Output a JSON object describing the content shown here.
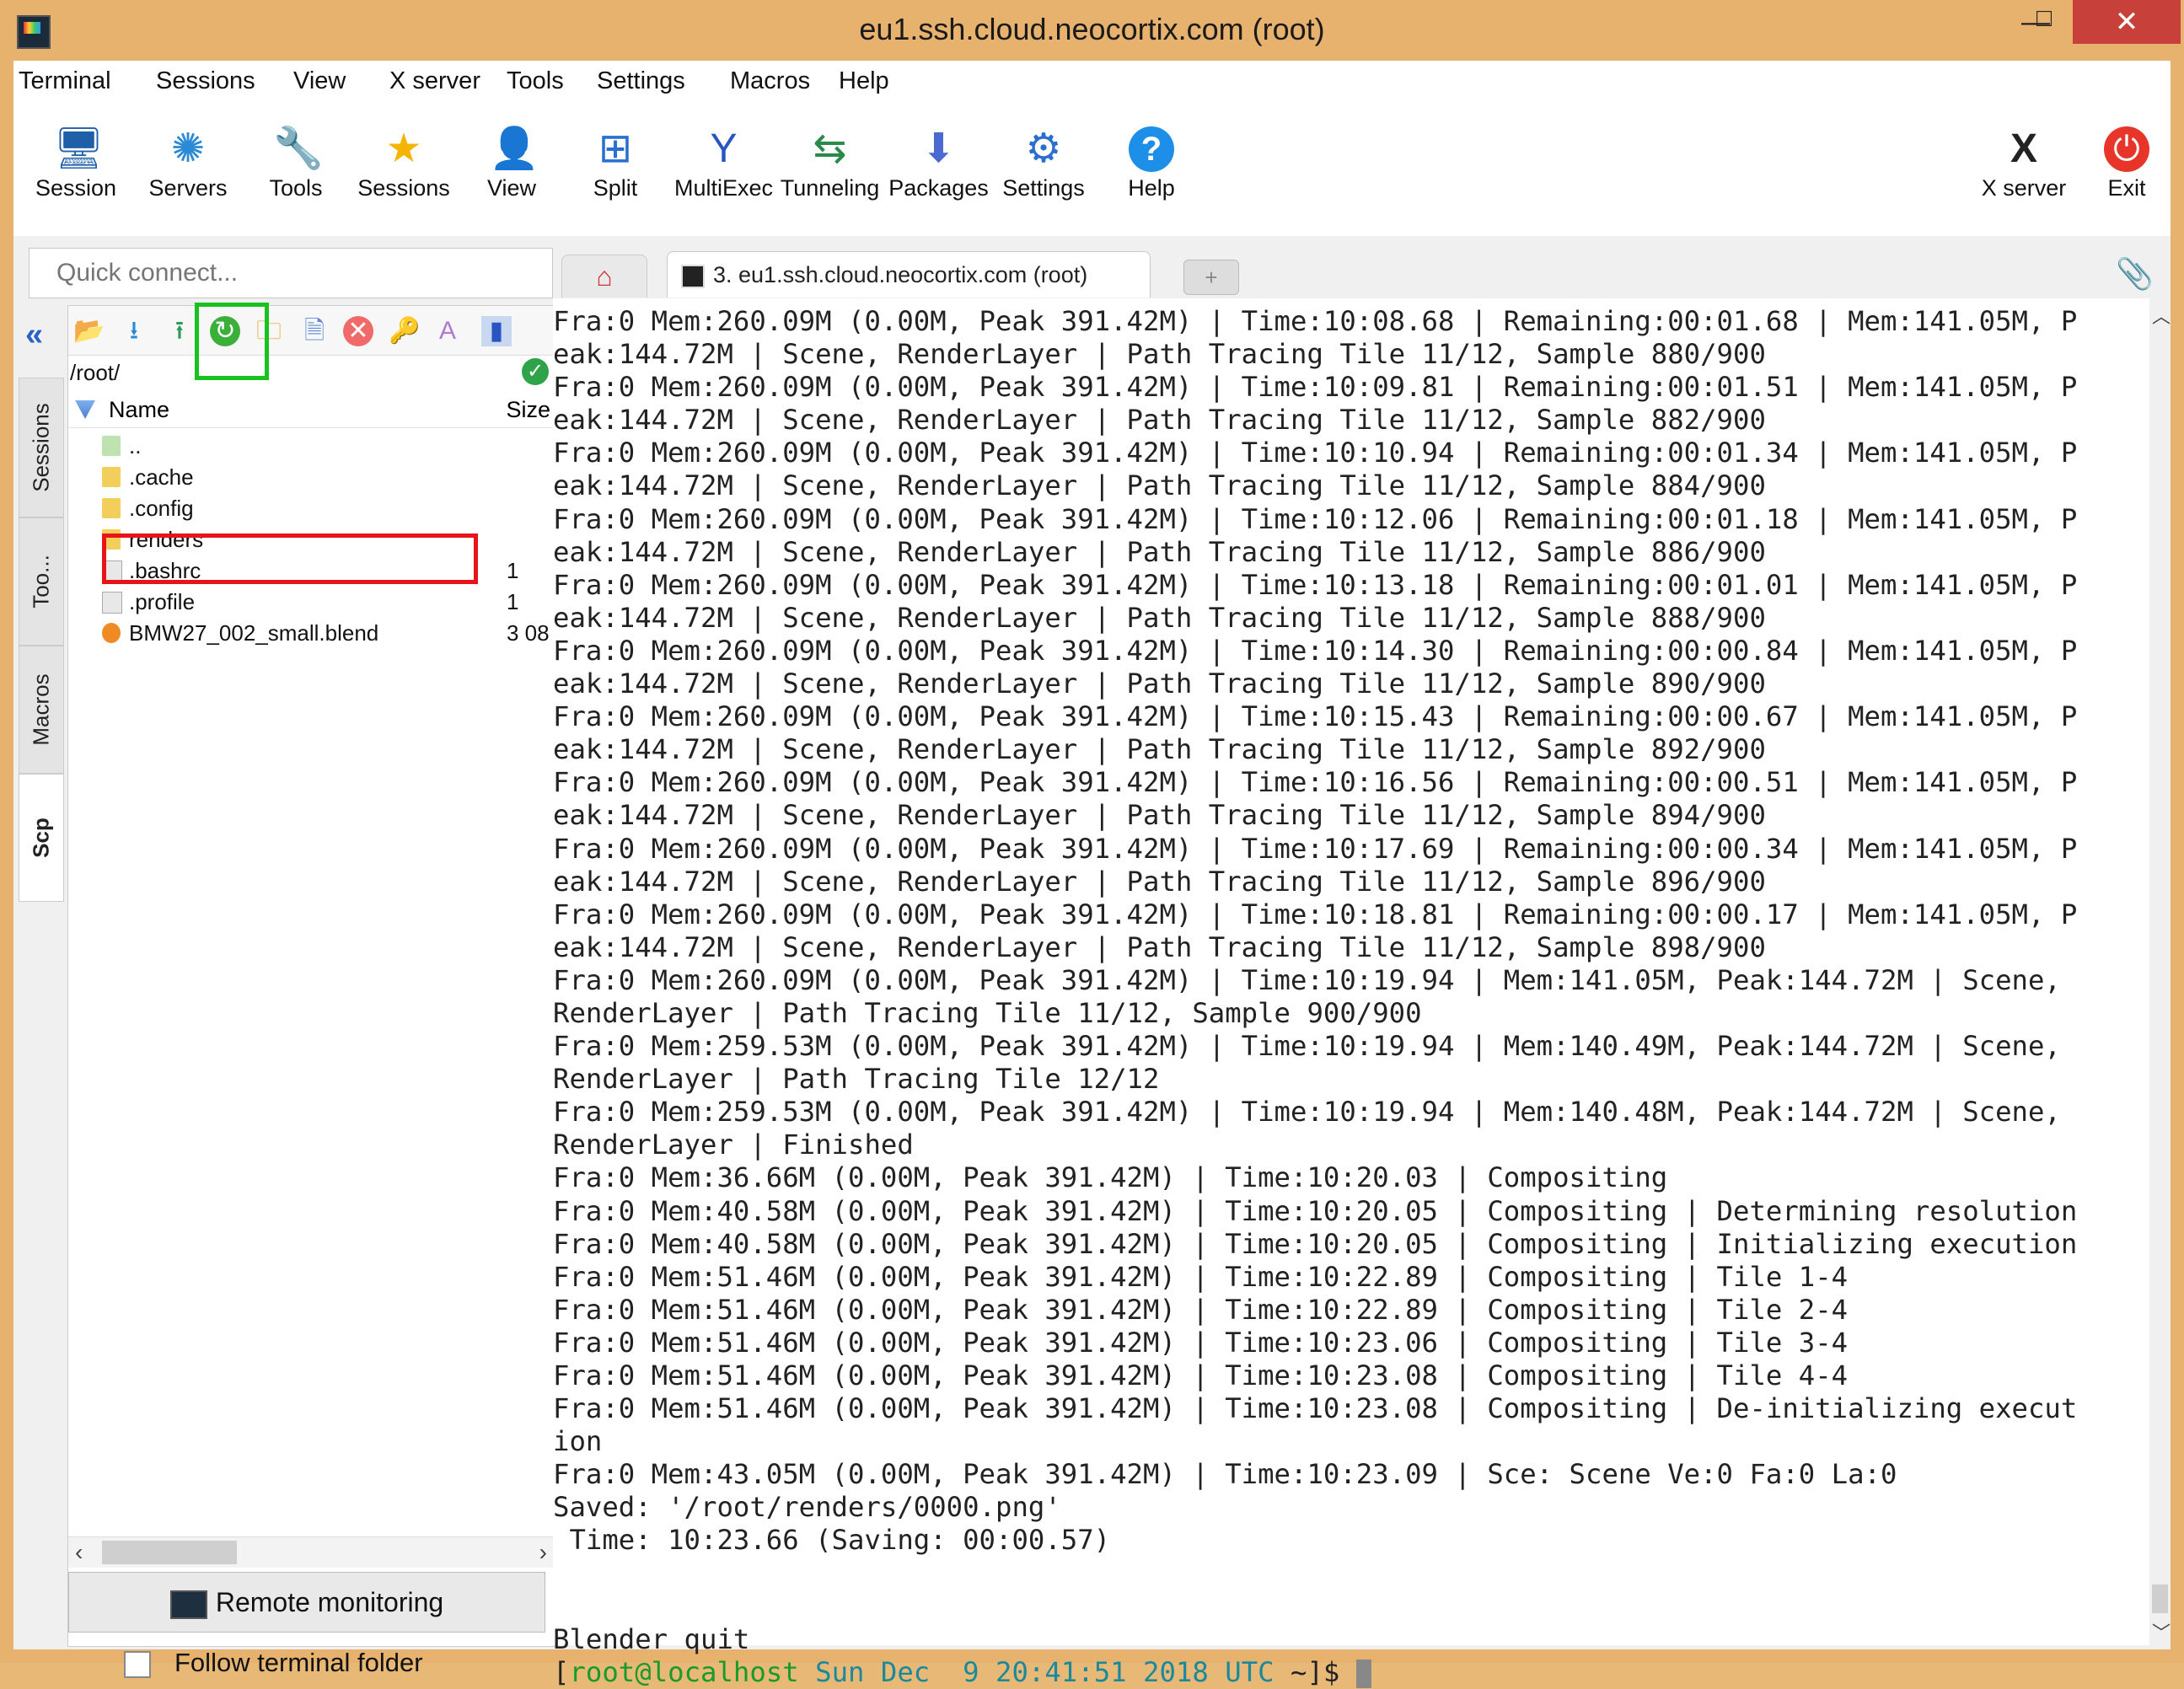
{
  "window": {
    "title": "eu1.ssh.cloud.neocortix.com (root)",
    "min": "—",
    "max": "□",
    "close": "✕"
  },
  "menu": [
    "Terminal",
    "Sessions",
    "View",
    "X server",
    "Tools",
    "Settings",
    "Macros",
    "Help"
  ],
  "toolbar": [
    {
      "label": "Session",
      "icon": "session-icon"
    },
    {
      "label": "Servers",
      "icon": "servers-icon"
    },
    {
      "label": "Tools",
      "icon": "tools-icon"
    },
    {
      "label": "Sessions",
      "icon": "star-icon"
    },
    {
      "label": "View",
      "icon": "view-icon"
    },
    {
      "label": "Split",
      "icon": "split-icon"
    },
    {
      "label": "MultiExec",
      "icon": "multiexec-icon"
    },
    {
      "label": "Tunneling",
      "icon": "tunneling-icon"
    },
    {
      "label": "Packages",
      "icon": "packages-icon"
    },
    {
      "label": "Settings",
      "icon": "gear-icon"
    },
    {
      "label": "Help",
      "icon": "help-icon"
    },
    {
      "label": "X server",
      "icon": "x-server-icon"
    },
    {
      "label": "Exit",
      "icon": "power-icon"
    }
  ],
  "quick_connect": {
    "placeholder": "Quick connect..."
  },
  "tabs": {
    "active_label": "3. eu1.ssh.cloud.neocortix.com (root)",
    "new_tab": "+"
  },
  "side_tabs": [
    "Sessions",
    "Too...",
    "Macros",
    "Scp"
  ],
  "sftp": {
    "path": "/root/",
    "columns": {
      "name": "Name",
      "size": "Size"
    },
    "files": [
      {
        "name": "..",
        "size": "",
        "type": "up"
      },
      {
        "name": ".cache",
        "size": "",
        "type": "folder"
      },
      {
        "name": ".config",
        "size": "",
        "type": "folder"
      },
      {
        "name": "renders",
        "size": "",
        "type": "folder"
      },
      {
        "name": ".bashrc",
        "size": "1",
        "type": "file"
      },
      {
        "name": ".profile",
        "size": "1",
        "type": "file"
      },
      {
        "name": "BMW27_002_small.blend",
        "size": "3 08",
        "type": "blend"
      }
    ],
    "remote_monitoring": "Remote monitoring",
    "follow_terminal": "Follow terminal folder"
  },
  "terminal": {
    "lines": [
      "Fra:0 Mem:260.09M (0.00M, Peak 391.42M) | Time:10:08.68 | Remaining:00:01.68 | Mem:141.05M, P",
      "eak:144.72M | Scene, RenderLayer | Path Tracing Tile 11/12, Sample 880/900",
      "Fra:0 Mem:260.09M (0.00M, Peak 391.42M) | Time:10:09.81 | Remaining:00:01.51 | Mem:141.05M, P",
      "eak:144.72M | Scene, RenderLayer | Path Tracing Tile 11/12, Sample 882/900",
      "Fra:0 Mem:260.09M (0.00M, Peak 391.42M) | Time:10:10.94 | Remaining:00:01.34 | Mem:141.05M, P",
      "eak:144.72M | Scene, RenderLayer | Path Tracing Tile 11/12, Sample 884/900",
      "Fra:0 Mem:260.09M (0.00M, Peak 391.42M) | Time:10:12.06 | Remaining:00:01.18 | Mem:141.05M, P",
      "eak:144.72M | Scene, RenderLayer | Path Tracing Tile 11/12, Sample 886/900",
      "Fra:0 Mem:260.09M (0.00M, Peak 391.42M) | Time:10:13.18 | Remaining:00:01.01 | Mem:141.05M, P",
      "eak:144.72M | Scene, RenderLayer | Path Tracing Tile 11/12, Sample 888/900",
      "Fra:0 Mem:260.09M (0.00M, Peak 391.42M) | Time:10:14.30 | Remaining:00:00.84 | Mem:141.05M, P",
      "eak:144.72M | Scene, RenderLayer | Path Tracing Tile 11/12, Sample 890/900",
      "Fra:0 Mem:260.09M (0.00M, Peak 391.42M) | Time:10:15.43 | Remaining:00:00.67 | Mem:141.05M, P",
      "eak:144.72M | Scene, RenderLayer | Path Tracing Tile 11/12, Sample 892/900",
      "Fra:0 Mem:260.09M (0.00M, Peak 391.42M) | Time:10:16.56 | Remaining:00:00.51 | Mem:141.05M, P",
      "eak:144.72M | Scene, RenderLayer | Path Tracing Tile 11/12, Sample 894/900",
      "Fra:0 Mem:260.09M (0.00M, Peak 391.42M) | Time:10:17.69 | Remaining:00:00.34 | Mem:141.05M, P",
      "eak:144.72M | Scene, RenderLayer | Path Tracing Tile 11/12, Sample 896/900",
      "Fra:0 Mem:260.09M (0.00M, Peak 391.42M) | Time:10:18.81 | Remaining:00:00.17 | Mem:141.05M, P",
      "eak:144.72M | Scene, RenderLayer | Path Tracing Tile 11/12, Sample 898/900",
      "Fra:0 Mem:260.09M (0.00M, Peak 391.42M) | Time:10:19.94 | Mem:141.05M, Peak:144.72M | Scene,",
      "RenderLayer | Path Tracing Tile 11/12, Sample 900/900",
      "Fra:0 Mem:259.53M (0.00M, Peak 391.42M) | Time:10:19.94 | Mem:140.49M, Peak:144.72M | Scene,",
      "RenderLayer | Path Tracing Tile 12/12",
      "Fra:0 Mem:259.53M (0.00M, Peak 391.42M) | Time:10:19.94 | Mem:140.48M, Peak:144.72M | Scene,",
      "RenderLayer | Finished",
      "Fra:0 Mem:36.66M (0.00M, Peak 391.42M) | Time:10:20.03 | Compositing",
      "Fra:0 Mem:40.58M (0.00M, Peak 391.42M) | Time:10:20.05 | Compositing | Determining resolution",
      "Fra:0 Mem:40.58M (0.00M, Peak 391.42M) | Time:10:20.05 | Compositing | Initializing execution",
      "Fra:0 Mem:51.46M (0.00M, Peak 391.42M) | Time:10:22.89 | Compositing | Tile 1-4",
      "Fra:0 Mem:51.46M (0.00M, Peak 391.42M) | Time:10:22.89 | Compositing | Tile 2-4",
      "Fra:0 Mem:51.46M (0.00M, Peak 391.42M) | Time:10:23.06 | Compositing | Tile 3-4",
      "Fra:0 Mem:51.46M (0.00M, Peak 391.42M) | Time:10:23.08 | Compositing | Tile 4-4",
      "Fra:0 Mem:51.46M (0.00M, Peak 391.42M) | Time:10:23.08 | Compositing | De-initializing execut",
      "ion",
      "Fra:0 Mem:43.05M (0.00M, Peak 391.42M) | Time:10:23.09 | Sce: Scene Ve:0 Fa:0 La:0",
      "Saved: '/root/renders/0000.png'",
      " Time: 10:23.66 (Saving: 00:00.57)",
      "",
      "",
      "Blender quit"
    ],
    "prompt": {
      "open": "[",
      "user": "root@localhost",
      "date": "Sun Dec  9 20:41:51 2018 UTC",
      "tail": " ~]$ "
    }
  }
}
